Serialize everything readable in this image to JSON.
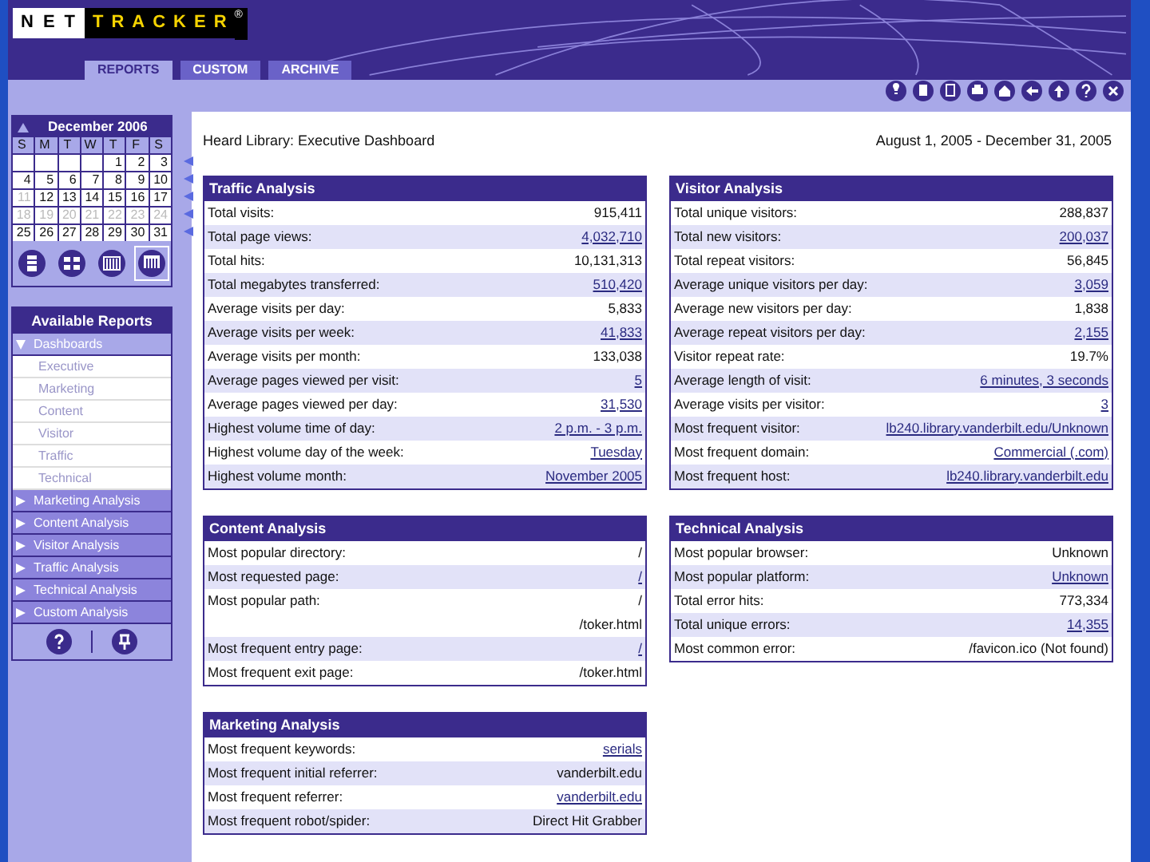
{
  "logo": {
    "part_1": "NET",
    "part_2": "TRACKER",
    "mark": "®"
  },
  "tabs": [
    {
      "label": "REPORTS",
      "selected": true
    },
    {
      "label": "CUSTOM",
      "selected": false
    },
    {
      "label": "ARCHIVE",
      "selected": false
    }
  ],
  "calendar": {
    "month": "December 2006",
    "weekdays": [
      "S",
      "M",
      "T",
      "W",
      "T",
      "F",
      "S"
    ],
    "weeks": [
      [
        {
          "kind": "blank"
        },
        {
          "kind": "blank"
        },
        {
          "kind": "blank"
        },
        {
          "kind": "blank"
        },
        {
          "kind": "day",
          "text": "1",
          "muted": false
        },
        {
          "kind": "day",
          "text": "2",
          "muted": false
        },
        {
          "kind": "day",
          "text": "3",
          "muted": false
        }
      ],
      [
        {
          "kind": "day",
          "text": "4",
          "muted": false
        },
        {
          "kind": "day",
          "text": "5",
          "muted": false
        },
        {
          "kind": "day",
          "text": "6",
          "muted": false
        },
        {
          "kind": "day",
          "text": "7",
          "muted": false
        },
        {
          "kind": "day",
          "text": "8",
          "muted": false
        },
        {
          "kind": "day",
          "text": "9",
          "muted": false
        },
        {
          "kind": "day",
          "text": "10",
          "muted": false
        }
      ],
      [
        {
          "kind": "day",
          "text": "11",
          "muted": true
        },
        {
          "kind": "day",
          "text": "12",
          "muted": false
        },
        {
          "kind": "day",
          "text": "13",
          "muted": false
        },
        {
          "kind": "day",
          "text": "14",
          "muted": false
        },
        {
          "kind": "day",
          "text": "15",
          "muted": false
        },
        {
          "kind": "day",
          "text": "16",
          "muted": false
        },
        {
          "kind": "day",
          "text": "17",
          "muted": false
        }
      ],
      [
        {
          "kind": "day",
          "text": "18",
          "muted": true
        },
        {
          "kind": "day",
          "text": "19",
          "muted": true
        },
        {
          "kind": "day",
          "text": "20",
          "muted": true
        },
        {
          "kind": "day",
          "text": "21",
          "muted": true
        },
        {
          "kind": "day",
          "text": "22",
          "muted": true
        },
        {
          "kind": "day",
          "text": "23",
          "muted": true
        },
        {
          "kind": "day",
          "text": "24",
          "muted": true
        }
      ],
      [
        {
          "kind": "day",
          "text": "25",
          "muted": false
        },
        {
          "kind": "day",
          "text": "26",
          "muted": false
        },
        {
          "kind": "day",
          "text": "27",
          "muted": false
        },
        {
          "kind": "day",
          "text": "28",
          "muted": false
        },
        {
          "kind": "day",
          "text": "29",
          "muted": false
        },
        {
          "kind": "day",
          "text": "30",
          "muted": false
        },
        {
          "kind": "day",
          "text": "31",
          "muted": false
        }
      ]
    ],
    "views": [
      {
        "kind": "day",
        "selected": false
      },
      {
        "kind": "week",
        "selected": false
      },
      {
        "kind": "month",
        "selected": false
      },
      {
        "kind": "range",
        "selected": true
      }
    ]
  },
  "reports": {
    "title": "Available Reports",
    "items": [
      {
        "label": "Dashboards",
        "expanded": true,
        "children": [
          {
            "label": "Executive"
          },
          {
            "label": "Marketing"
          },
          {
            "label": "Content"
          },
          {
            "label": "Visitor"
          },
          {
            "label": "Traffic"
          },
          {
            "label": "Technical"
          }
        ]
      },
      {
        "label": "Marketing Analysis",
        "expanded": false
      },
      {
        "label": "Content Analysis",
        "expanded": false
      },
      {
        "label": "Visitor Analysis",
        "expanded": false
      },
      {
        "label": "Traffic Analysis",
        "expanded": false
      },
      {
        "label": "Technical Analysis",
        "expanded": false
      },
      {
        "label": "Custom Analysis",
        "expanded": false
      }
    ]
  },
  "page_title": "Heard Library: Executive Dashboard",
  "date_range": "August 1, 2005 - December 31, 2005",
  "panels": [
    {
      "title": "Traffic Analysis",
      "rows": [
        {
          "label": "Total visits:",
          "values": [
            "915,411"
          ],
          "link": false
        },
        {
          "label": "Total page views:",
          "values": [
            "4,032,710"
          ],
          "link": true
        },
        {
          "label": "Total hits:",
          "values": [
            "10,131,313"
          ],
          "link": false
        },
        {
          "label": "Total megabytes transferred:",
          "values": [
            "510,420"
          ],
          "link": true
        },
        {
          "label": "Average visits per day:",
          "values": [
            "5,833"
          ],
          "link": false
        },
        {
          "label": "Average visits per week:",
          "values": [
            "41,833"
          ],
          "link": true
        },
        {
          "label": "Average visits per month:",
          "values": [
            "133,038"
          ],
          "link": false
        },
        {
          "label": "Average pages viewed per visit:",
          "values": [
            "5"
          ],
          "link": true
        },
        {
          "label": "Average pages viewed per day:",
          "values": [
            "31,530"
          ],
          "link": true
        },
        {
          "label": "Highest volume time of day:",
          "values": [
            "2 p.m. - 3 p.m."
          ],
          "link": true
        },
        {
          "label": "Highest volume day of the week:",
          "values": [
            "Tuesday"
          ],
          "link": true
        },
        {
          "label": "Highest volume month:",
          "values": [
            "November 2005"
          ],
          "link": true
        }
      ]
    },
    {
      "title": "Visitor Analysis",
      "rows": [
        {
          "label": "Total unique visitors:",
          "values": [
            "288,837"
          ],
          "link": false
        },
        {
          "label": "Total new visitors:",
          "values": [
            "200,037"
          ],
          "link": true
        },
        {
          "label": "Total repeat visitors:",
          "values": [
            "56,845"
          ],
          "link": false
        },
        {
          "label": "Average unique visitors per day:",
          "values": [
            "3,059"
          ],
          "link": true
        },
        {
          "label": "Average new visitors per day:",
          "values": [
            "1,838"
          ],
          "link": false
        },
        {
          "label": "Average repeat visitors per day:",
          "values": [
            "2,155"
          ],
          "link": true
        },
        {
          "label": "Visitor repeat rate:",
          "values": [
            "19.7%"
          ],
          "link": false
        },
        {
          "label": "Average length of visit:",
          "values": [
            "6 minutes, 3 seconds"
          ],
          "link": true
        },
        {
          "label": "Average visits per visitor:",
          "values": [
            "3"
          ],
          "link": true
        },
        {
          "label": "Most frequent visitor:",
          "values": [
            "lb240.library.vanderbilt.edu/Unknown"
          ],
          "link": true
        },
        {
          "label": "Most frequent domain:",
          "values": [
            "Commercial (.com)"
          ],
          "link": true
        },
        {
          "label": "Most frequent host:",
          "values": [
            "lb240.library.vanderbilt.edu"
          ],
          "link": true
        }
      ]
    },
    {
      "title": "Content Analysis",
      "rows": [
        {
          "label": "Most popular directory:",
          "values": [
            "/"
          ],
          "link": false
        },
        {
          "label": "Most requested page:",
          "values": [
            "/"
          ],
          "link": true
        },
        {
          "label": "Most popular path:",
          "values": [
            "/",
            "/toker.html"
          ],
          "link": false
        },
        {
          "label": "Most frequent entry page:",
          "values": [
            "/"
          ],
          "link": true
        },
        {
          "label": "Most frequent exit page:",
          "values": [
            "/toker.html"
          ],
          "link": false
        }
      ]
    },
    {
      "title": "Technical Analysis",
      "rows": [
        {
          "label": "Most popular browser:",
          "values": [
            "Unknown"
          ],
          "link": false
        },
        {
          "label": "Most popular platform:",
          "values": [
            "Unknown"
          ],
          "link": true
        },
        {
          "label": "Total error hits:",
          "values": [
            "773,334"
          ],
          "link": false
        },
        {
          "label": "Total unique errors:",
          "values": [
            "14,355"
          ],
          "link": true
        },
        {
          "label": "Most common error:",
          "values": [
            "/favicon.ico (Not found)"
          ],
          "link": false
        }
      ]
    },
    {
      "title": "Marketing Analysis",
      "rows": [
        {
          "label": "Most frequent keywords:",
          "values": [
            "serials"
          ],
          "link": true
        },
        {
          "label": "Most frequent initial referrer:",
          "values": [
            "vanderbilt.edu"
          ],
          "link": false
        },
        {
          "label": "Most frequent referrer:",
          "values": [
            "vanderbilt.edu"
          ],
          "link": true
        },
        {
          "label": "Most frequent robot/spider:",
          "values": [
            "Direct Hit Grabber"
          ],
          "link": false
        }
      ]
    }
  ]
}
